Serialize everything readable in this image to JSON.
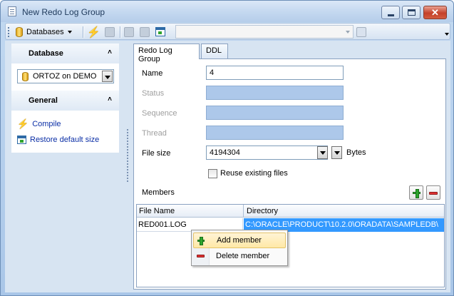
{
  "window": {
    "title": "New Redo Log Group"
  },
  "toolbar": {
    "databases_label": "Databases",
    "combo_value": ""
  },
  "left_panel": {
    "database_group": {
      "title": "Database",
      "selected_db": "ORTOZ on DEMO"
    },
    "general_group": {
      "title": "General",
      "items": [
        {
          "label": "Compile",
          "icon": "lightning-icon"
        },
        {
          "label": "Restore default size",
          "icon": "window-restore-icon"
        }
      ]
    }
  },
  "tabs": [
    {
      "label": "Redo Log Group",
      "active": true
    },
    {
      "label": "DDL",
      "active": false
    }
  ],
  "form": {
    "name": {
      "label": "Name",
      "value": "4"
    },
    "status": {
      "label": "Status",
      "value": ""
    },
    "sequence": {
      "label": "Sequence",
      "value": ""
    },
    "thread": {
      "label": "Thread",
      "value": ""
    },
    "file_size": {
      "label": "File size",
      "value": "4194304",
      "units": "Bytes"
    },
    "reuse": {
      "label": "Reuse existing files",
      "checked": false
    }
  },
  "members": {
    "label": "Members",
    "columns": [
      "File Name",
      "Directory"
    ],
    "rows": [
      {
        "file_name": "RED001.LOG",
        "directory": "C:\\ORACLE\\PRODUCT\\10.2.0\\ORADATA\\SAMPLEDB\\"
      }
    ]
  },
  "context_menu": {
    "items": [
      {
        "label": "Add member",
        "highlighted": true
      },
      {
        "label": "Delete member",
        "highlighted": false
      }
    ]
  },
  "colors": {
    "selection": "#3399ff",
    "disabled_field": "#adc8ea",
    "link": "#0b2fa6"
  }
}
